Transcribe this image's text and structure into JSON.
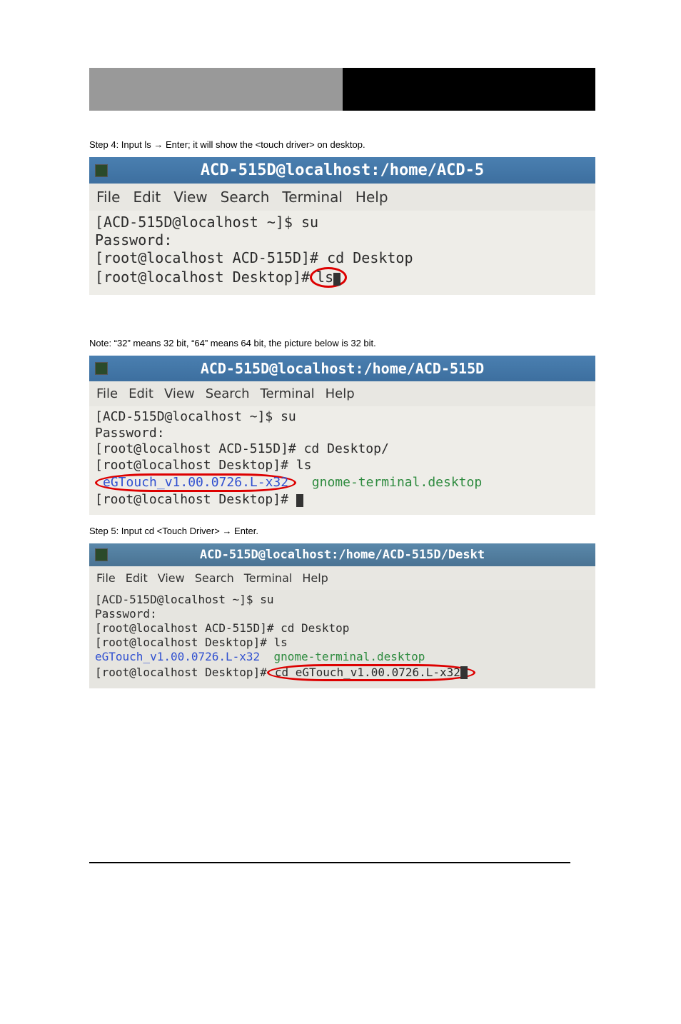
{
  "tabs": {
    "left": "",
    "right": ""
  },
  "instr1_pre": "Step 4: Input ls ",
  "arrow": "→",
  "instr1_post": " Enter; it will show the <touch driver> on desktop.",
  "menus": {
    "file": "File",
    "edit": "Edit",
    "view": "View",
    "search": "Search",
    "terminal": "Terminal",
    "help": "Help"
  },
  "s1": {
    "title": "ACD-515D@localhost:/home/ACD-5",
    "l1": "[ACD-515D@localhost ~]$ su",
    "l2": "Password:",
    "l3": "[root@localhost ACD-515D]# cd Desktop",
    "l4a": "[root@localhost Desktop]#",
    "l4b": "ls"
  },
  "note": "Note: “32” means 32 bit, “64” means 64 bit, the picture below is 32 bit.",
  "s2": {
    "title": "ACD-515D@localhost:/home/ACD-515D",
    "l1": "[ACD-515D@localhost ~]$ su",
    "l2": "Password:",
    "l3": "[root@localhost ACD-515D]# cd Desktop/",
    "l4": "[root@localhost Desktop]# ls",
    "l5a": "eGTouch_v1.00.0726.L-x32",
    "l5b": "  gnome-terminal.desktop",
    "l6": "[root@localhost Desktop]# "
  },
  "instr2_pre": "Step 5: Input cd <Touch Driver> ",
  "instr2_post": " Enter.",
  "s3": {
    "title": "ACD-515D@localhost:/home/ACD-515D/Deskt",
    "l1": "[ACD-515D@localhost ~]$ su",
    "l2": "Password:",
    "l3": "[root@localhost ACD-515D]# cd Desktop",
    "l4": "[root@localhost Desktop]# ls",
    "l5a": "eGTouch_v1.00.0726.L-x32",
    "l5b": "  gnome-terminal.desktop",
    "l6a": "[root@localhost Desktop]#",
    "l6b": "cd eGTouch_v1.00.0726.L-x32"
  }
}
